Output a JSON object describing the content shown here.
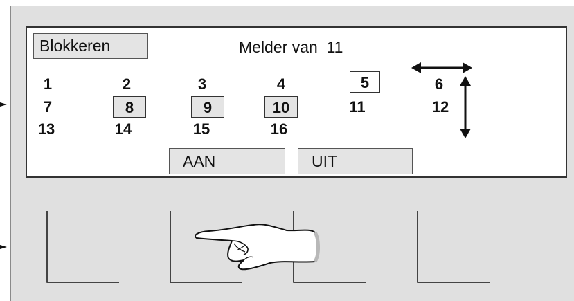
{
  "window": {
    "block_button": "Blokkeren",
    "title_prefix": "Melder van",
    "title_count": "11",
    "on_button": "AAN",
    "off_button": "UIT"
  },
  "detectors": [
    {
      "label": "1"
    },
    {
      "label": "2"
    },
    {
      "label": "3"
    },
    {
      "label": "4"
    },
    {
      "label": "5",
      "state": "selected"
    },
    {
      "label": "6"
    },
    {
      "label": "7"
    },
    {
      "label": "8",
      "state": "blocked"
    },
    {
      "label": "9",
      "state": "blocked"
    },
    {
      "label": "10",
      "state": "blocked"
    },
    {
      "label": "11"
    },
    {
      "label": "12"
    },
    {
      "label": "13"
    },
    {
      "label": "14"
    },
    {
      "label": "15"
    },
    {
      "label": "16"
    }
  ],
  "icons": {
    "horizontal_arrow": "left-right-arrow-icon",
    "vertical_arrow": "up-down-arrow-icon",
    "pointer": "pointing-hand-icon"
  },
  "colors": {
    "panel": "#e0e0e0",
    "screen": "#ffffff",
    "button": "#e4e4e4",
    "ink": "#111111"
  }
}
